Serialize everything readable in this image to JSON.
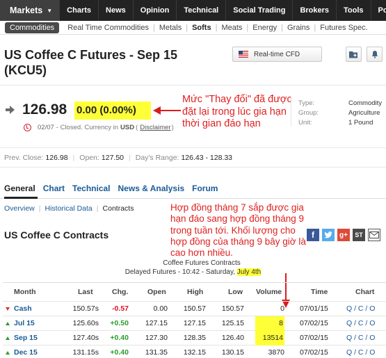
{
  "topnav": {
    "items": [
      "Markets",
      "Charts",
      "News",
      "Opinion",
      "Technical",
      "Social Trading",
      "Brokers",
      "Tools",
      "Por"
    ]
  },
  "subnav": {
    "active_pill": "Commodities",
    "links": [
      "Real Time Commodities",
      "Metals",
      "Softs",
      "Meats",
      "Energy",
      "Grains",
      "Futures Spec."
    ]
  },
  "header": {
    "title_line1": "US Coffee C Futures - Sep 15",
    "title_line2": "(KCU5)",
    "cfd_label": "Real-time CFD"
  },
  "quote": {
    "price": "126.98",
    "change": "0.00  (0.00%)",
    "date": "02/07",
    "status_text": "- Closed. Currency in",
    "currency": "USD",
    "disclaimer": "Disclaimer"
  },
  "annotations": {
    "note1": "Mức \"Thay đổi\" đã được đặt lại trong lúc gia hạn thời gian đáo hạn",
    "note2": "Hợp đồng tháng 7 sắp được gia hạn đáo sang hợp đồng tháng 9 trong tuần tới. Khối lượng cho hợp đồng của tháng 9 bây giờ là cao hơn nhiều."
  },
  "info": {
    "type_label": "Type:",
    "type_value": "Commodity",
    "group_label": "Group:",
    "group_value": "Agriculture",
    "unit_label": "Unit:",
    "unit_value": "1 Pound"
  },
  "stats": {
    "prev_close_label": "Prev. Close:",
    "prev_close": "126.98",
    "open_label": "Open:",
    "open": "127.50",
    "range_label": "Day's Range:",
    "range": "126.43 - 128.33"
  },
  "tabs": [
    "General",
    "Chart",
    "Technical",
    "News & Analysis",
    "Forum"
  ],
  "subtabs": [
    "Overview",
    "Historical Data",
    "Contracts"
  ],
  "contracts": {
    "title": "US Coffee C Contracts",
    "caption_line1": "Coffee Futures Contracts",
    "caption_line2": "Delayed Futures - 10:42 - Saturday,",
    "caption_date": "July 4th",
    "columns": [
      "Month",
      "Last",
      "Chg.",
      "Open",
      "High",
      "Low",
      "Volume",
      "Time",
      "Chart"
    ],
    "rows": [
      {
        "month": "Cash",
        "last": "150.57s",
        "chg": "-0.57",
        "open": "0.00",
        "high": "150.57",
        "low": "150.57",
        "volume": "0",
        "time": "07/01/15",
        "chart": "Q / C / O",
        "dir": "down"
      },
      {
        "month": "Jul 15",
        "last": "125.60s",
        "chg": "+0.50",
        "open": "127.15",
        "high": "127.15",
        "low": "125.15",
        "volume": "8",
        "time": "07/02/15",
        "chart": "Q / C / O",
        "dir": "up"
      },
      {
        "month": "Sep 15",
        "last": "127.40s",
        "chg": "+0.40",
        "open": "127.30",
        "high": "128.35",
        "low": "126.40",
        "volume": "13514",
        "time": "07/02/15",
        "chart": "Q / C / O",
        "dir": "up"
      },
      {
        "month": "Dec 15",
        "last": "131.15s",
        "chg": "+0.40",
        "open": "131.35",
        "high": "132.15",
        "low": "130.15",
        "volume": "3870",
        "time": "07/02/15",
        "chart": "Q / C / O",
        "dir": "up"
      }
    ]
  },
  "colors": {
    "highlight": "#ffff37",
    "annotation_red": "#e02020",
    "link_blue": "#1a5a96",
    "positive": "#2a9d2a",
    "negative": "#d12222"
  }
}
